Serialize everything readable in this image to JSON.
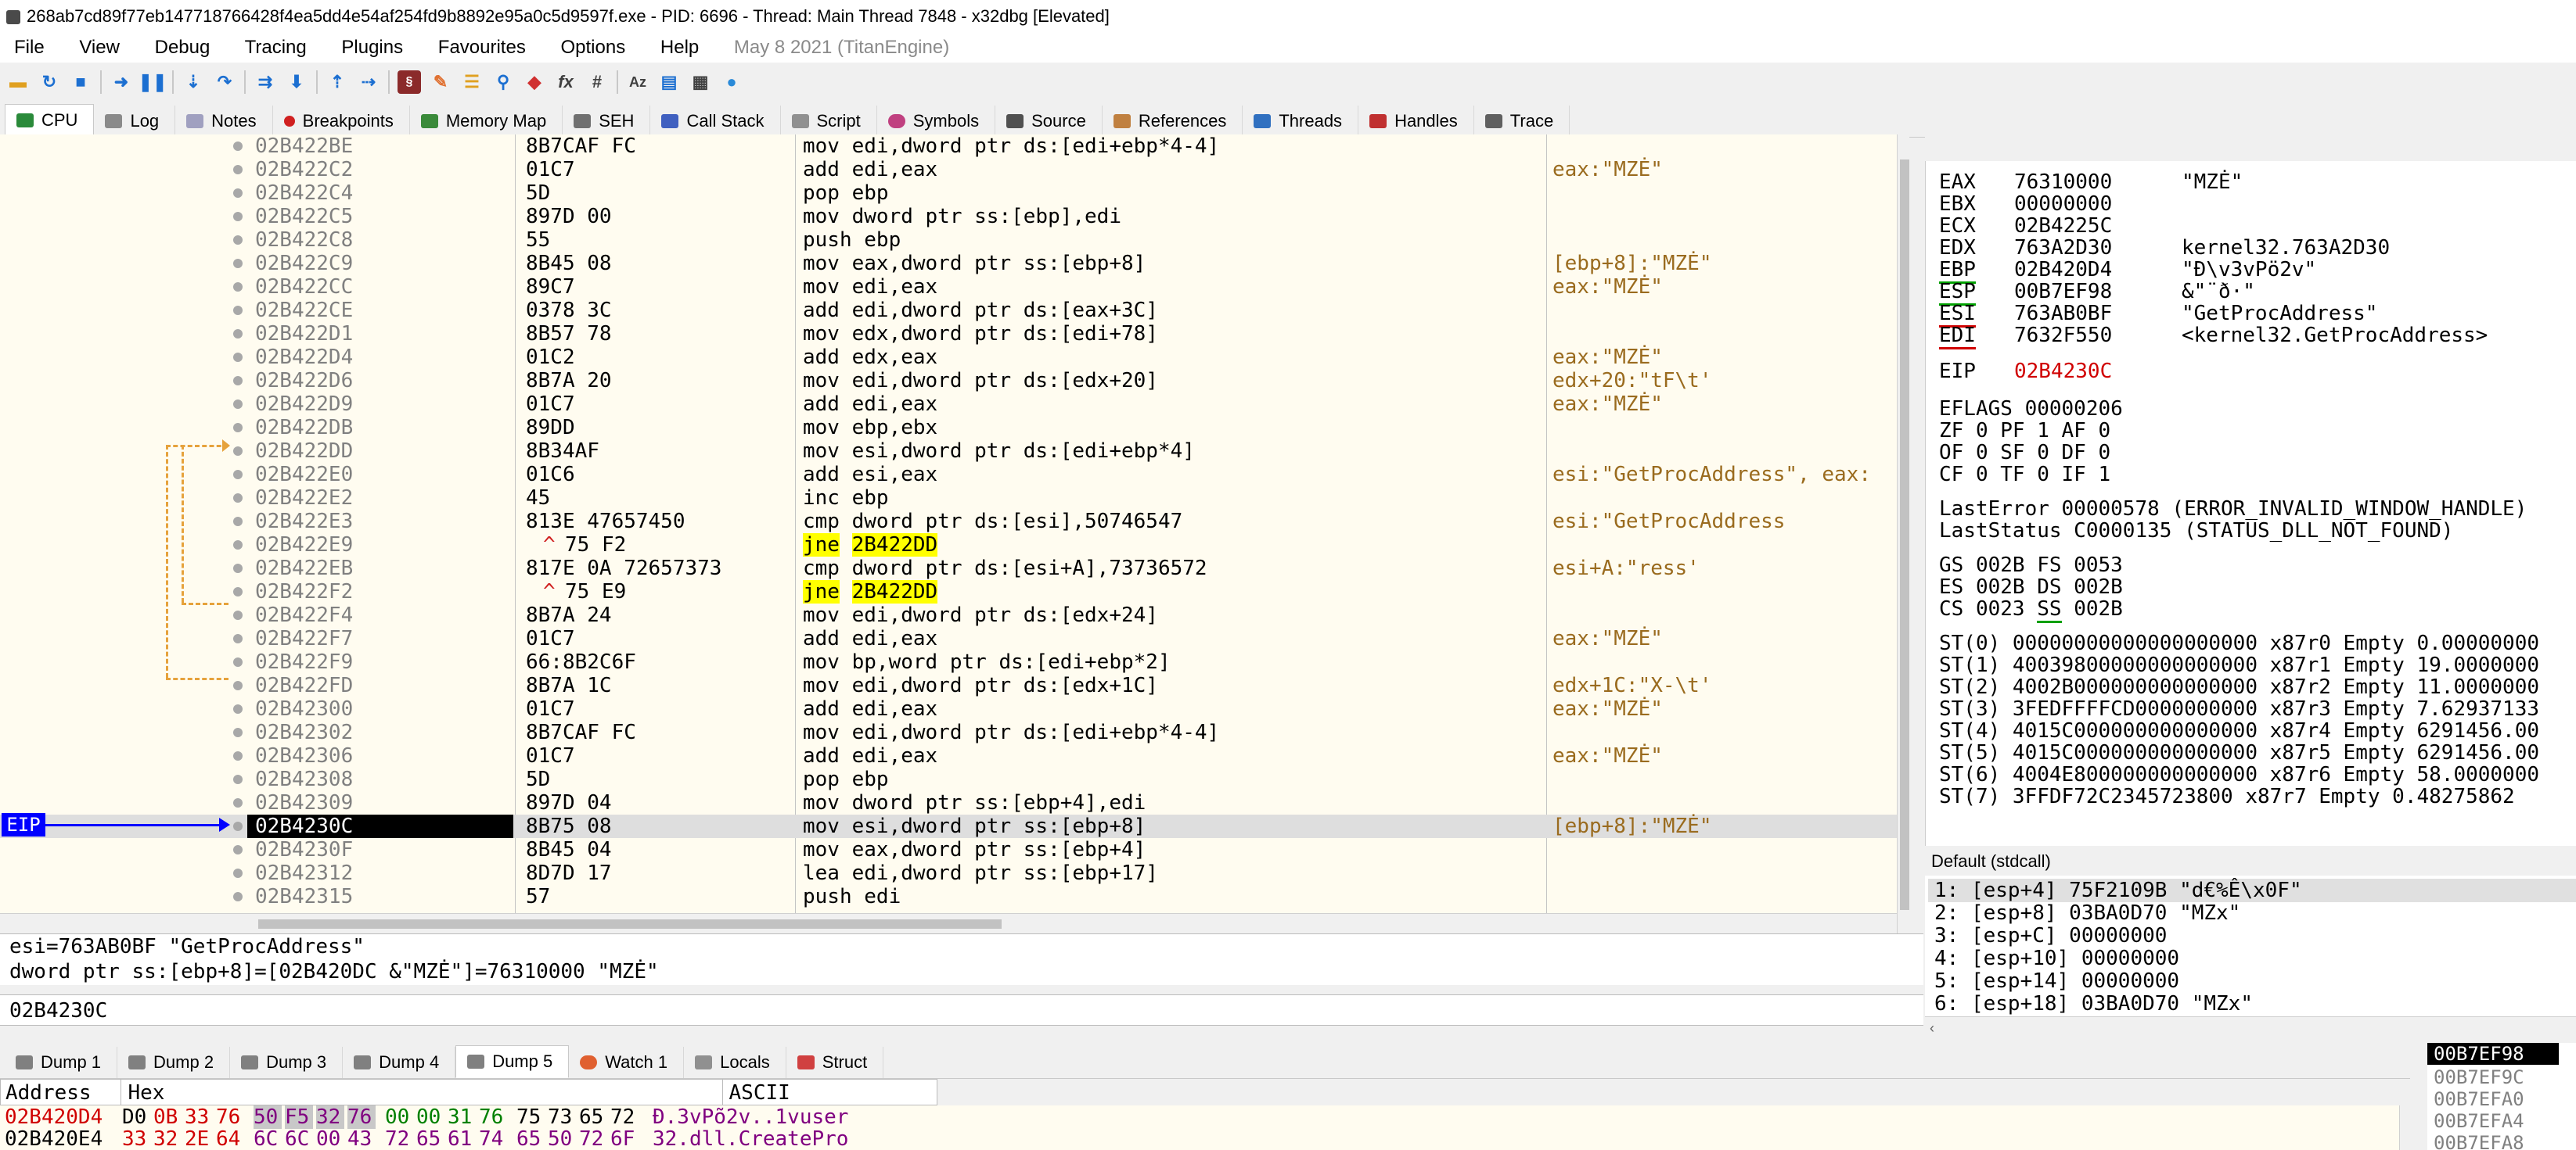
{
  "window": {
    "title": "268ab7cd89f77eb147718766428f4ea5dd4e54af254fd9b8892e95a0c5d9597f.exe - PID: 6696 - Thread: Main Thread 7848 - x32dbg [Elevated]"
  },
  "menu": {
    "items": [
      "File",
      "View",
      "Debug",
      "Tracing",
      "Plugins",
      "Favourites",
      "Options",
      "Help"
    ],
    "info": "May 8 2021 (TitanEngine)"
  },
  "tabs": {
    "main": [
      "CPU",
      "Log",
      "Notes",
      "Breakpoints",
      "Memory Map",
      "SEH",
      "Call Stack",
      "Script",
      "Symbols",
      "Source",
      "References",
      "Threads",
      "Handles",
      "Trace"
    ],
    "dump": [
      "Dump 1",
      "Dump 2",
      "Dump 3",
      "Dump 4",
      "Dump 5",
      "Watch 1",
      "Locals",
      "Struct"
    ]
  },
  "disasm": {
    "eip_label": "EIP",
    "rows": [
      {
        "addr": "02B422BE",
        "bytes": "8B7CAF FC",
        "ins": "mov edi,dword ptr ds:[edi+ebp*4-4]",
        "cmt": ""
      },
      {
        "addr": "02B422C2",
        "bytes": "01C7",
        "ins": "add edi,eax",
        "cmt": "eax:\"MZĖ\""
      },
      {
        "addr": "02B422C4",
        "bytes": "5D",
        "ins": "pop ebp",
        "cmt": ""
      },
      {
        "addr": "02B422C5",
        "bytes": "897D 00",
        "ins": "mov dword ptr ss:[ebp],edi",
        "cmt": ""
      },
      {
        "addr": "02B422C8",
        "bytes": "55",
        "ins": "push ebp",
        "cmt": ""
      },
      {
        "addr": "02B422C9",
        "bytes": "8B45 08",
        "ins": "mov eax,dword ptr ss:[ebp+8]",
        "cmt": "[ebp+8]:\"MZĖ\""
      },
      {
        "addr": "02B422CC",
        "bytes": "89C7",
        "ins": "mov edi,eax",
        "cmt": "eax:\"MZĖ\""
      },
      {
        "addr": "02B422CE",
        "bytes": "0378 3C",
        "ins": "add edi,dword ptr ds:[eax+3C]",
        "cmt": ""
      },
      {
        "addr": "02B422D1",
        "bytes": "8B57 78",
        "ins": "mov edx,dword ptr ds:[edi+78]",
        "cmt": ""
      },
      {
        "addr": "02B422D4",
        "bytes": "01C2",
        "ins": "add edx,eax",
        "cmt": "eax:\"MZĖ\""
      },
      {
        "addr": "02B422D6",
        "bytes": "8B7A 20",
        "ins": "mov edi,dword ptr ds:[edx+20]",
        "cmt": "edx+20:\"tF\\t'"
      },
      {
        "addr": "02B422D9",
        "bytes": "01C7",
        "ins": "add edi,eax",
        "cmt": "eax:\"MZĖ\""
      },
      {
        "addr": "02B422DB",
        "bytes": "89DD",
        "ins": "mov ebp,ebx",
        "cmt": ""
      },
      {
        "addr": "02B422DD",
        "bytes": "8B34AF",
        "ins": "mov esi,dword ptr ds:[edi+ebp*4]",
        "cmt": ""
      },
      {
        "addr": "02B422E0",
        "bytes": "01C6",
        "ins": "add esi,eax",
        "cmt": "esi:\"GetProcAddress\", eax:"
      },
      {
        "addr": "02B422E2",
        "bytes": "45",
        "ins": "inc ebp",
        "cmt": ""
      },
      {
        "addr": "02B422E3",
        "bytes": "813E 47657450",
        "ins": "cmp dword ptr ds:[esi],50746547",
        "cmt": "esi:\"GetProcAddress"
      },
      {
        "addr": "02B422E9",
        "bytes": "75 F2",
        "ins": "jne 2B422DD",
        "cmt": "",
        "jmp": true
      },
      {
        "addr": "02B422EB",
        "bytes": "817E 0A 72657373",
        "ins": "cmp dword ptr ds:[esi+A],73736572",
        "cmt": "esi+A:\"ress'"
      },
      {
        "addr": "02B422F2",
        "bytes": "75 E9",
        "ins": "jne 2B422DD",
        "cmt": "",
        "jmp": true
      },
      {
        "addr": "02B422F4",
        "bytes": "8B7A 24",
        "ins": "mov edi,dword ptr ds:[edx+24]",
        "cmt": ""
      },
      {
        "addr": "02B422F7",
        "bytes": "01C7",
        "ins": "add edi,eax",
        "cmt": "eax:\"MZĖ\""
      },
      {
        "addr": "02B422F9",
        "bytes": "66:8B2C6F",
        "ins": "mov bp,word ptr ds:[edi+ebp*2]",
        "cmt": ""
      },
      {
        "addr": "02B422FD",
        "bytes": "8B7A 1C",
        "ins": "mov edi,dword ptr ds:[edx+1C]",
        "cmt": "edx+1C:\"X-\\t'"
      },
      {
        "addr": "02B42300",
        "bytes": "01C7",
        "ins": "add edi,eax",
        "cmt": "eax:\"MZĖ\""
      },
      {
        "addr": "02B42302",
        "bytes": "8B7CAF FC",
        "ins": "mov edi,dword ptr ds:[edi+ebp*4-4]",
        "cmt": ""
      },
      {
        "addr": "02B42306",
        "bytes": "01C7",
        "ins": "add edi,eax",
        "cmt": "eax:\"MZĖ\""
      },
      {
        "addr": "02B42308",
        "bytes": "5D",
        "ins": "pop ebp",
        "cmt": ""
      },
      {
        "addr": "02B42309",
        "bytes": "897D 04",
        "ins": "mov dword ptr ss:[ebp+4],edi",
        "cmt": ""
      },
      {
        "addr": "02B4230C",
        "bytes": "8B75 08",
        "ins": "mov esi,dword ptr ss:[ebp+8]",
        "cmt": "[ebp+8]:\"MZĖ\"",
        "eip": true
      },
      {
        "addr": "02B4230F",
        "bytes": "8B45 04",
        "ins": "mov eax,dword ptr ss:[ebp+4]",
        "cmt": ""
      },
      {
        "addr": "02B42312",
        "bytes": "8D7D 17",
        "ins": "lea edi,dword ptr ss:[ebp+17]",
        "cmt": ""
      },
      {
        "addr": "02B42315",
        "bytes": "57",
        "ins": "push edi",
        "cmt": ""
      }
    ]
  },
  "info": {
    "line1": "esi=763AB0BF \"GetProcAddress\"",
    "line2": "dword ptr ss:[ebp+8]=[02B420DC &\"MZĖ\"]=76310000 \"MZĖ\""
  },
  "address_bar": "02B4230C",
  "registers": {
    "gp": [
      {
        "name": "EAX",
        "val": "76310000",
        "desc": "\"MZĖ\""
      },
      {
        "name": "EBX",
        "val": "00000000",
        "desc": ""
      },
      {
        "name": "ECX",
        "val": "02B4225C",
        "desc": ""
      },
      {
        "name": "EDX",
        "val": "763A2D30",
        "desc": "kernel32.763A2D30"
      },
      {
        "name": "EBP",
        "val": "02B420D4",
        "desc": "\"Ð\\v3vPö2v\""
      },
      {
        "name": "ESP",
        "val": "00B7EF98",
        "desc": "&\"¨ð·\""
      },
      {
        "name": "ESI",
        "val": "763AB0BF",
        "desc": "\"GetProcAddress\""
      },
      {
        "name": "EDI",
        "val": "7632F550",
        "desc": "<kernel32.GetProcAddress>"
      }
    ],
    "eip": {
      "name": "EIP",
      "val": "02B4230C"
    },
    "eflags": "EFLAGS   00000206",
    "flags": [
      "ZF 0  PF 1  AF 0",
      "OF 0  SF 0  DF 0",
      "CF 0  TF 0  IF 1"
    ],
    "last_error": "LastError  00000578 (ERROR_INVALID_WINDOW_HANDLE)",
    "last_status": "LastStatus C0000135 (STATUS_DLL_NOT_FOUND)",
    "segs": [
      "GS 002B  FS 0053",
      "ES 002B  DS 002B",
      "CS 0023  SS 002B"
    ],
    "fpu": [
      "ST(0) 00000000000000000000 x87r0 Empty 0.00000000",
      "ST(1) 40039800000000000000 x87r1 Empty 19.0000000",
      "ST(2) 4002B000000000000000 x87r2 Empty 11.0000000",
      "ST(3) 3FEDFFFFCD0000000000 x87r3 Empty 7.62937133",
      "ST(4) 4015C000000000000000 x87r4 Empty 6291456.00",
      "ST(5) 4015C000000000000000 x87r5 Empty 6291456.00",
      "ST(6) 4004E800000000000000 x87r6 Empty 58.0000000",
      "ST(7) 3FFDF72C2345723800 x87r7 Empty 0.48275862"
    ]
  },
  "stack_args": {
    "header": "Default (stdcall)",
    "rows": [
      "1: [esp+4] 75F2109B \"d€%Ê\\x0F\"",
      "2: [esp+8] 03BA0D70 \"MZx\"",
      "3: [esp+C] 00000000",
      "4: [esp+10] 00000000",
      "5: [esp+14] 00000000",
      "6: [esp+18] 03BA0D70 \"MZx\""
    ]
  },
  "dump": {
    "col_address": "Address",
    "col_hex": "Hex",
    "col_ascii": "ASCII",
    "rows": [
      {
        "addr": "02B420D4",
        "hex": [
          "D0",
          "0B",
          "33",
          "76",
          "50",
          "F5",
          "32",
          "76",
          "00",
          "00",
          "31",
          "76",
          "75",
          "73",
          "65",
          "72"
        ],
        "ascii": "Ð.3vPõ2v..1vuser"
      },
      {
        "addr": "02B420E4",
        "hex": [
          "33",
          "32",
          "2E",
          "64",
          "6C",
          "6C",
          "00",
          "43",
          "72",
          "65",
          "61",
          "74",
          "65",
          "50",
          "72",
          "6F"
        ],
        "ascii": "32.dll.CreatePro"
      }
    ]
  },
  "stack_mini": {
    "top": "00B7EF98",
    "rows": [
      "00B7EF9C",
      "00B7EFA0",
      "00B7EFA4",
      "00B7EFA8"
    ]
  }
}
